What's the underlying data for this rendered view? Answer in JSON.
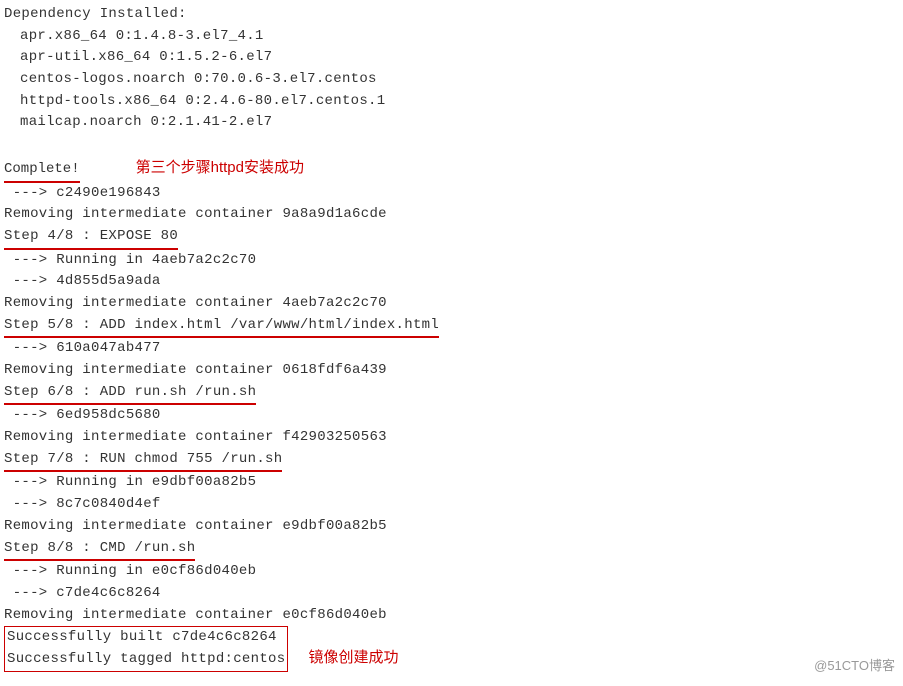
{
  "header": "Dependency Installed:",
  "deps": [
    "apr.x86_64 0:1.4.8-3.el7_4.1",
    "apr-util.x86_64 0:1.5.2-6.el7",
    "centos-logos.noarch 0:70.0.6-3.el7.centos",
    "httpd-tools.x86_64 0:2.4.6-80.el7.centos.1",
    "mailcap.noarch 0:2.1.41-2.el7"
  ],
  "complete": "Complete!",
  "annotation1": "第三个步骤httpd安装成功",
  "build": {
    "l1": " ---> c2490e196843",
    "l2": "Removing intermediate container 9a8a9d1a6cde",
    "s4": "Step 4/8 : EXPOSE 80",
    "l3": " ---> Running in 4aeb7a2c2c70",
    "l4": " ---> 4d855d5a9ada",
    "l5": "Removing intermediate container 4aeb7a2c2c70",
    "s5": "Step 5/8 : ADD index.html /var/www/html/index.html",
    "l6": " ---> 610a047ab477",
    "l7": "Removing intermediate container 0618fdf6a439",
    "s6": "Step 6/8 : ADD run.sh /run.sh",
    "l8": " ---> 6ed958dc5680",
    "l9": "Removing intermediate container f42903250563",
    "s7": "Step 7/8 : RUN chmod 755 /run.sh",
    "l10": " ---> Running in e9dbf00a82b5",
    "l11": " ---> 8c7c0840d4ef",
    "l12": "Removing intermediate container e9dbf00a82b5",
    "s8": "Step 8/8 : CMD /run.sh",
    "l13": " ---> Running in e0cf86d040eb",
    "l14": " ---> c7de4c6c8264",
    "l15": "Removing intermediate container e0cf86d040eb",
    "ok1": "Successfully built c7de4c6c8264",
    "ok2": "Successfully tagged httpd:centos"
  },
  "annotation2": "镜像创建成功",
  "watermark": "@51CTO博客"
}
